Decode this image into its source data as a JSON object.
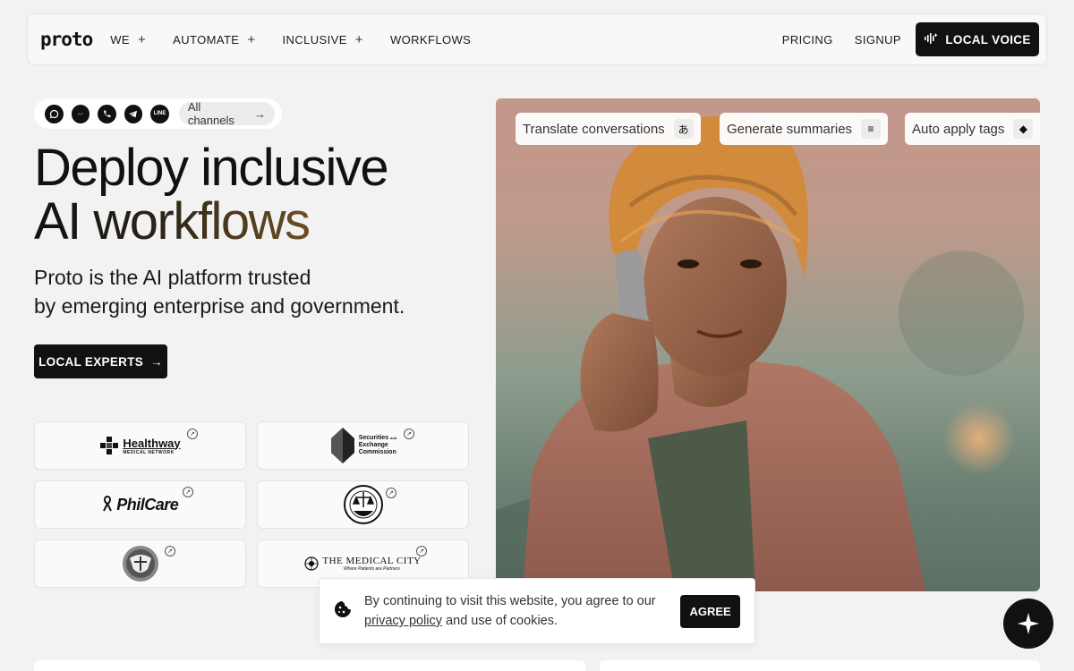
{
  "nav": {
    "logo": "proto",
    "menu": [
      {
        "label": "WE",
        "expand": "+"
      },
      {
        "label": "AUTOMATE",
        "expand": "+"
      },
      {
        "label": "INCLUSIVE",
        "expand": "+"
      },
      {
        "label": "WORKFLOWS"
      }
    ],
    "pricing": "PRICING",
    "signup": "SIGNUP",
    "voice_button": "LOCAL VOICE"
  },
  "channels": {
    "icons": [
      "whatsapp-icon",
      "messenger-icon",
      "phone-icon",
      "telegram-icon",
      "line-icon"
    ],
    "line_icon_text": "LINE",
    "all_label": "All channels",
    "arrow": "→"
  },
  "hero": {
    "title_line1": "Deploy inclusive",
    "title_line2": "AI workflows",
    "subtitle_line1": "Proto is the AI platform trusted",
    "subtitle_line2": "by emerging enterprise and government.",
    "cta": "LOCAL EXPERTS",
    "cta_arrow": "→"
  },
  "clients": {
    "healthway_name": "Healthway",
    "healthway_sub": "MEDICAL NETWORK",
    "sec_line1": "Securities",
    "sec_line1_sup": "and",
    "sec_line2": "Exchange",
    "sec_line3": "Commission",
    "philcare": "PhilCare",
    "tmc_name": "THE MEDICAL CITY",
    "tmc_sub": "Where Patients are Partners",
    "ext_glyph": "↗"
  },
  "photo": {
    "chips": [
      {
        "label": "Translate conversations",
        "icon_name": "translate-icon",
        "glyph": "あ"
      },
      {
        "label": "Generate summaries",
        "icon_name": "summary-icon",
        "glyph": "≡"
      },
      {
        "label": "Auto apply tags",
        "icon_name": "tag-icon",
        "glyph": "◆"
      }
    ]
  },
  "cookie": {
    "text_before": "By continuing to visit this website, you agree to our ",
    "link": "privacy policy",
    "text_after": " and use of cookies.",
    "agree": "AGREE"
  },
  "colors": {
    "accent": "#111111",
    "background": "#f2f2f2",
    "gradient_end": "#6b4f22"
  }
}
